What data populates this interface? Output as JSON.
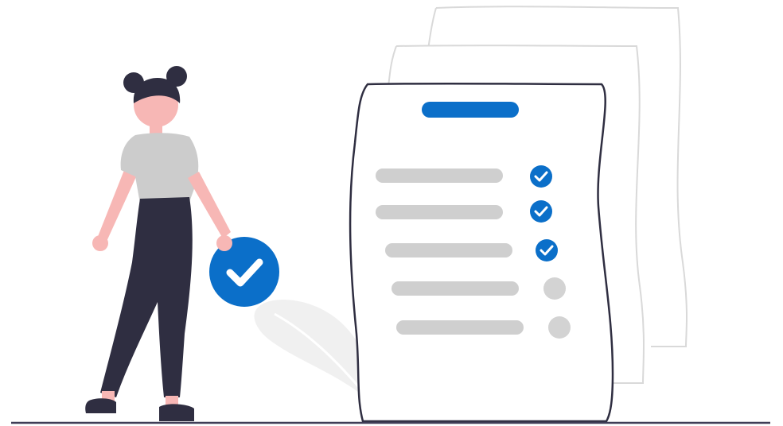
{
  "illustration": {
    "subject": "woman-holding-check-badge-beside-checklist",
    "colors": {
      "accent": "#0b6fc9",
      "skin": "#f7b7b5",
      "hair": "#2f2e41",
      "pants": "#2f2e41",
      "shirt": "#cccccc",
      "lines": "#cfcfcf",
      "pending": "#d3d3d3",
      "paper_outline": "#2f2e41",
      "back_paper_outline": "#d9d9d9",
      "leaf": "#f0f0f0",
      "ground": "#3f3d56"
    },
    "checklist": {
      "items": [
        {
          "done": true
        },
        {
          "done": true
        },
        {
          "done": true
        },
        {
          "done": false
        },
        {
          "done": false
        }
      ]
    },
    "icons": [
      "check-badge-icon",
      "checkmark-icon",
      "pending-circle-icon"
    ]
  }
}
